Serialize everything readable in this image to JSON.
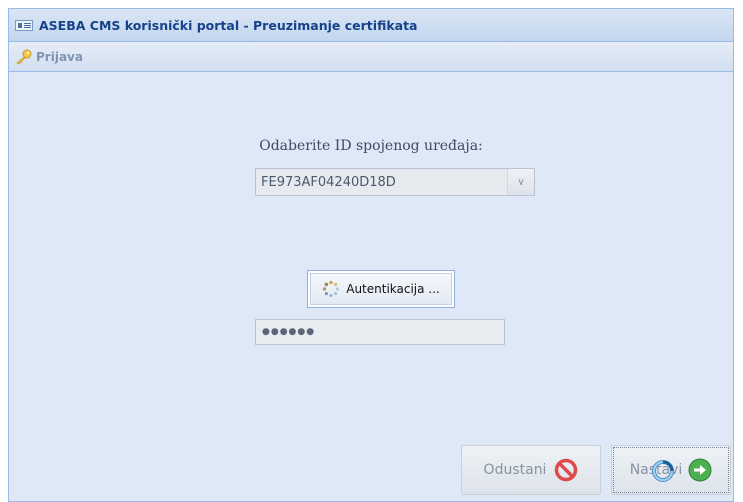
{
  "window": {
    "title": "ASEBA CMS korisnički portal - Preuzimanje certifikata",
    "icon": "window-icon"
  },
  "toolbar": {
    "login_label": "Prijava",
    "login_icon": "key-icon"
  },
  "form": {
    "device_prompt": "Odaberite ID spojenog uređaja:",
    "device_selected": "FE973AF04240D18D",
    "auth_button_label": "Autentikacija ...",
    "password_mask": "●●●●●●"
  },
  "footer": {
    "cancel_label": "Odustani",
    "cancel_icon": "no-entry-icon",
    "next_label": "Nastavi",
    "next_icon": "arrow-right-circle-icon"
  },
  "colors": {
    "title_text": "#15428b",
    "panel_bg": "#dfe8f6",
    "cancel_icon": "#e04a4a",
    "next_icon": "#4caf50"
  }
}
